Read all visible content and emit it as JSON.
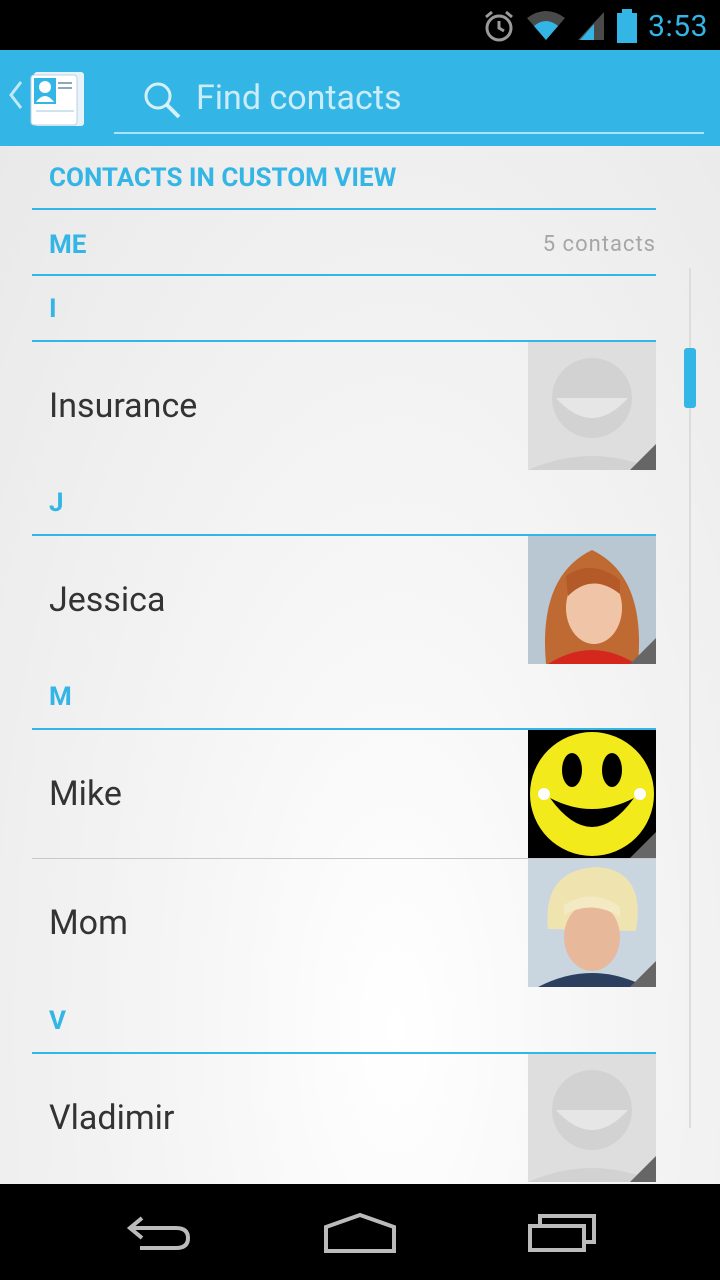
{
  "status_bar": {
    "time": "3:53",
    "icons": [
      "alarm-icon",
      "wifi-icon",
      "signal-icon",
      "battery-icon"
    ]
  },
  "action_bar": {
    "search_placeholder": "Find contacts"
  },
  "list": {
    "header": "CONTACTS IN CUSTOM VIEW",
    "me_label": "ME",
    "me_count": "5 contacts",
    "sections": [
      {
        "letter": "I",
        "contacts": [
          {
            "name": "Insurance",
            "avatar": "default-avatar"
          }
        ]
      },
      {
        "letter": "J",
        "contacts": [
          {
            "name": "Jessica",
            "avatar": "photo-avatar"
          }
        ]
      },
      {
        "letter": "M",
        "contacts": [
          {
            "name": "Mike",
            "avatar": "smiley-avatar"
          },
          {
            "name": "Mom",
            "avatar": "photo-avatar"
          }
        ]
      },
      {
        "letter": "V",
        "contacts": [
          {
            "name": "Vladimir",
            "avatar": "default-avatar"
          }
        ]
      }
    ]
  },
  "colors": {
    "accent": "#33b5e5",
    "status_bar": "#000000",
    "nav_bar": "#000000"
  },
  "nav_bar": {
    "buttons": [
      "back-icon",
      "home-icon",
      "recents-icon"
    ]
  }
}
